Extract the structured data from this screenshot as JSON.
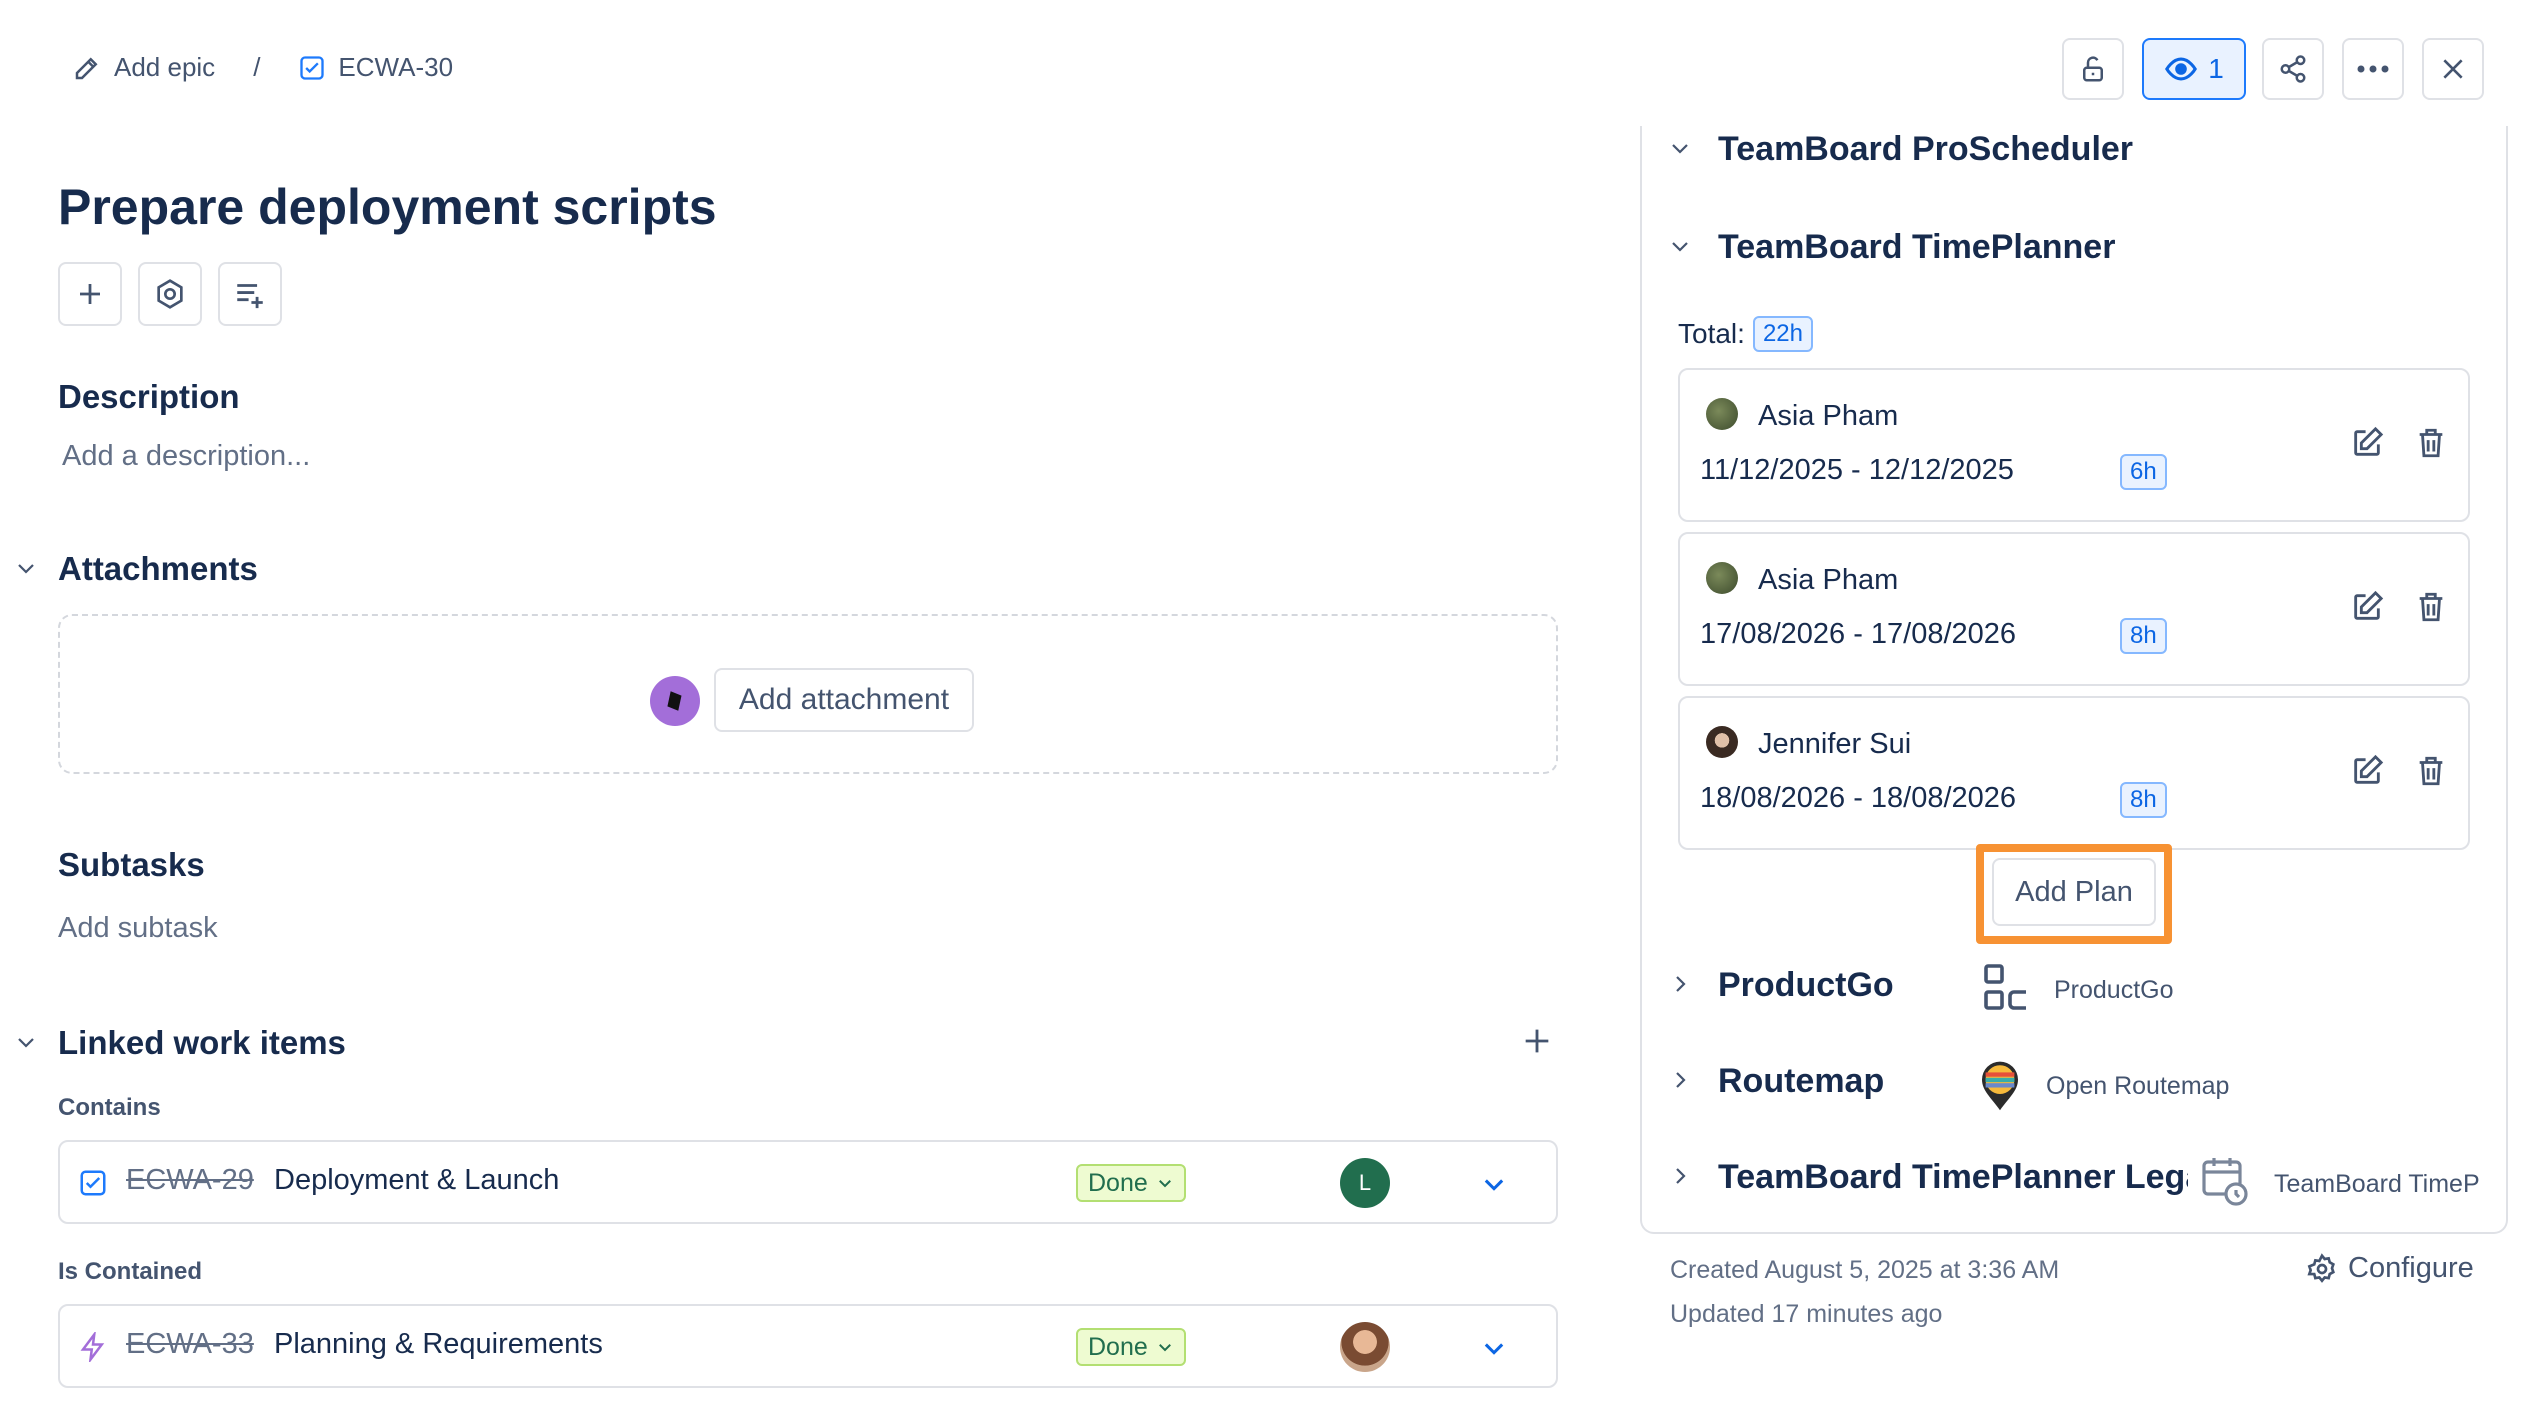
{
  "breadcrumb": {
    "epic_label": "Add epic",
    "separator": "/",
    "issue_key": "ECWA-30"
  },
  "header": {
    "watch_count": "1"
  },
  "issue": {
    "title": "Prepare deployment scripts",
    "description_heading": "Description",
    "description_placeholder": "Add a description...",
    "attachments_heading": "Attachments",
    "add_attachment_label": "Add attachment",
    "subtasks_heading": "Subtasks",
    "add_subtask_label": "Add subtask",
    "linked_heading": "Linked work items"
  },
  "linked": {
    "groups": [
      {
        "label": "Contains",
        "item": {
          "key": "ECWA-29",
          "summary": "Deployment & Launch",
          "status": "Done",
          "assignee_initial": "L"
        }
      },
      {
        "label": "Is Contained",
        "item": {
          "key": "ECWA-33",
          "summary": "Planning & Requirements",
          "status": "Done"
        }
      }
    ]
  },
  "panel": {
    "apps": [
      {
        "name": "TeamBoard ProScheduler"
      },
      {
        "name": "TeamBoard TimePlanner"
      },
      {
        "name": "ProductGo",
        "link": "ProductGo"
      },
      {
        "name": "Routemap",
        "link": "Open Routemap"
      },
      {
        "name": "TeamBoard TimePlanner Legac",
        "link": "TeamBoard TimeP"
      }
    ],
    "total_label": "Total:",
    "total_value": "22h",
    "plans": [
      {
        "name": "Asia Pham",
        "dates": "11/12/2025 - 12/12/2025",
        "hours": "6h"
      },
      {
        "name": "Asia Pham",
        "dates": "17/08/2026 - 17/08/2026",
        "hours": "8h"
      },
      {
        "name": "Jennifer Sui",
        "dates": "18/08/2026 - 18/08/2026",
        "hours": "8h"
      }
    ],
    "add_plan_label": "Add Plan"
  },
  "footer": {
    "created": "Created August 5, 2025 at 3:36 AM",
    "updated": "Updated 17 minutes ago",
    "configure_label": "Configure"
  },
  "colors": {
    "accent": "#0c66e4",
    "highlight": "#f79233",
    "done_bg": "#eefbd1",
    "lozenge": "#216e4e"
  }
}
